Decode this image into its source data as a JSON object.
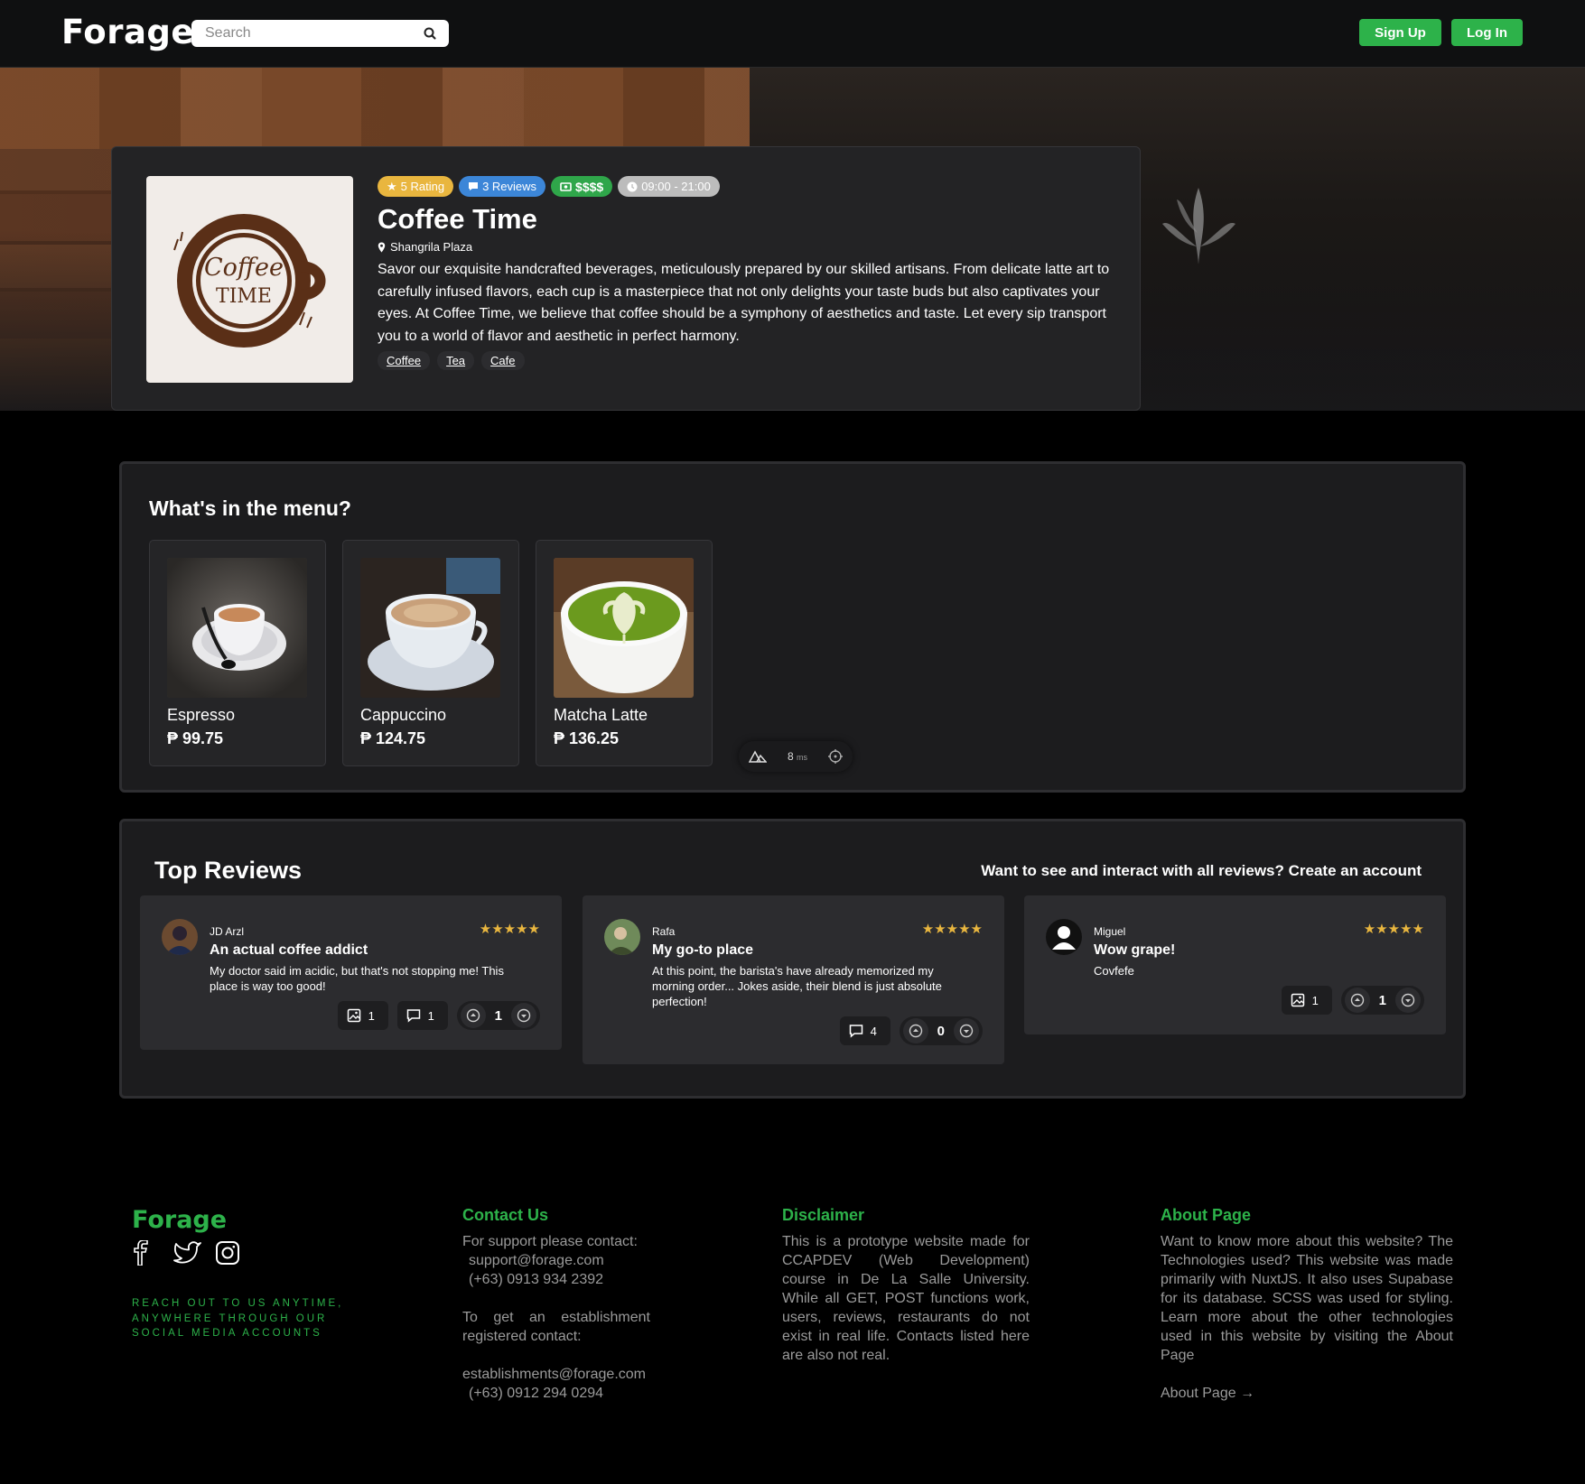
{
  "nav": {
    "logo": "Forage",
    "search_placeholder": "Search",
    "signup_label": "Sign Up",
    "login_label": "Log In"
  },
  "store": {
    "rating_badge": "5 Rating",
    "reviews_badge": "3 Reviews",
    "price_badge": "$$$$",
    "hours_badge": "09:00 - 21:00",
    "name": "Coffee Time",
    "location": "Shangrila Plaza",
    "description": "Savor our exquisite handcrafted beverages, meticulously prepared by our skilled artisans. From delicate latte art to carefully infused flavors, each cup is a masterpiece that not only delights your taste buds but also captivates your eyes. At Coffee Time, we believe that coffee should be a symphony of aesthetics and taste. Let every sip transport you to a world of flavor and aesthetic in perfect harmony.",
    "tags": [
      "Coffee",
      "Tea",
      "Cafe"
    ],
    "logo_text_1": "Coffee",
    "logo_text_2": "TIME"
  },
  "menu": {
    "title": "What's in the menu?",
    "items": [
      {
        "name": "Espresso",
        "price": "₱ 99.75"
      },
      {
        "name": "Cappuccino",
        "price": "₱ 124.75"
      },
      {
        "name": "Matcha Latte",
        "price": "₱ 136.25"
      }
    ],
    "devbar_ms": "8",
    "devbar_unit": "ms"
  },
  "reviews": {
    "title": "Top Reviews",
    "cta": "Want to see and interact with all reviews? Create an account",
    "items": [
      {
        "user": "JD Arzl",
        "stars": "★★★★★",
        "title": "An actual coffee addict",
        "body": "My doctor said im acidic, but that's not stopping me! This place is way too good!",
        "images": "1",
        "comments": "1",
        "votes": "1"
      },
      {
        "user": "Rafa",
        "stars": "★★★★★",
        "title": "My go-to place",
        "body": "At this point, the barista's have already memorized my morning order... Jokes aside, their blend is just absolute perfection!",
        "comments": "4",
        "votes": "0"
      },
      {
        "user": "Miguel",
        "stars": "★★★★★",
        "title": "Wow grape!",
        "body": "Covfefe",
        "images": "1",
        "votes": "1"
      }
    ]
  },
  "footer": {
    "logo": "Forage",
    "tagline": "REACH OUT TO US ANYTIME, ANYWHERE THROUGH OUR SOCIAL MEDIA ACCOUNTS",
    "contact": {
      "heading": "Contact Us",
      "support_intro": "For support please contact:",
      "support_email": "support@forage.com",
      "support_phone": "(+63) 0913 934 2392",
      "est_intro": "To get an establishment registered contact:",
      "est_email": "establishments@forage.com",
      "est_phone": "(+63) 0912 294 0294"
    },
    "disclaimer": {
      "heading": "Disclaimer",
      "text": "This is a prototype website made for CCAPDEV (Web Development) course in De La Salle University. While all GET, POST functions work, users, reviews, restaurants do not exist in real life. Contacts listed here are also not real."
    },
    "about": {
      "heading": "About Page",
      "text": "Want to know more about this website? The Technologies used? This website was made primarily with NuxtJS. It also uses Supabase for its database. SCSS was used for styling. Learn more about the other technologies used in this website by visiting the About Page",
      "link": "About Page →"
    }
  }
}
